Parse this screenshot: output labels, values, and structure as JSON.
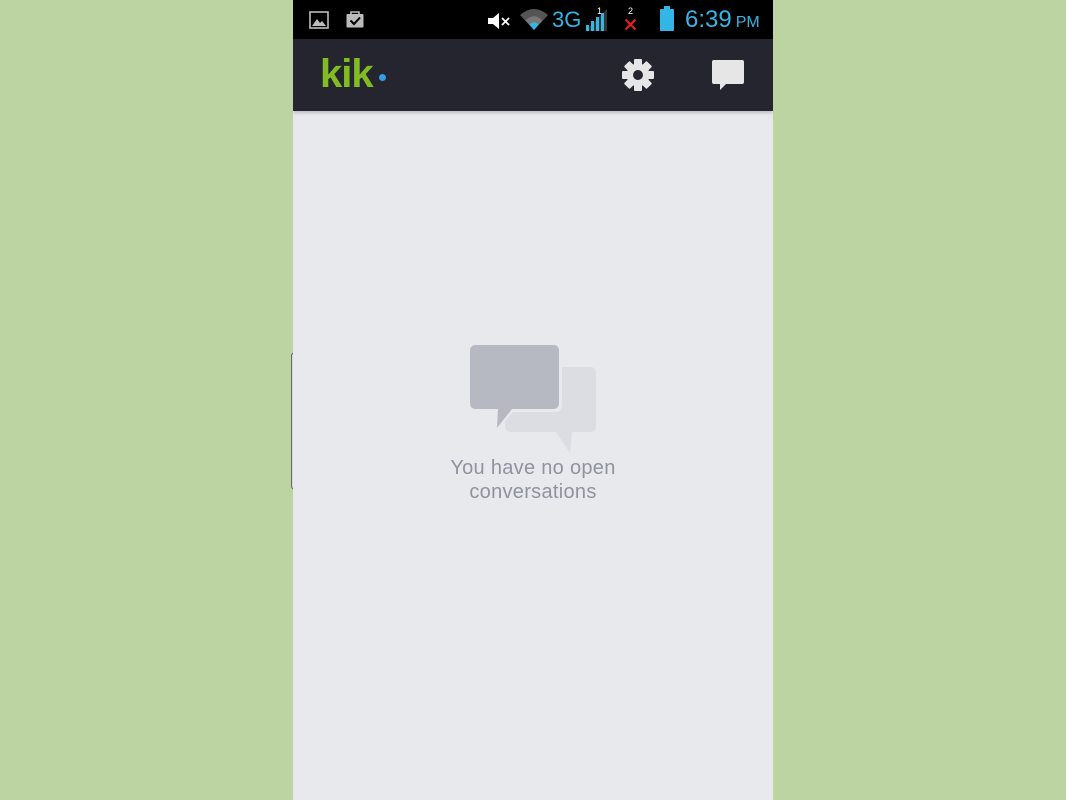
{
  "status_bar": {
    "network_type": "3G",
    "time": "6:39",
    "ampm": "PM",
    "sim1_label": "1",
    "sim2_label": "2",
    "icons": [
      "image-icon",
      "bag-check-icon",
      "mute-icon",
      "wifi-icon",
      "signal-icon",
      "no-signal-icon",
      "battery-icon"
    ]
  },
  "header": {
    "logo": "kik",
    "colors": {
      "background": "#24252e",
      "logo_green": "#82bc23",
      "logo_dot": "#2f9fe3"
    },
    "icons": [
      "settings-gear-icon",
      "new-chat-icon"
    ]
  },
  "empty_state": {
    "line1": "You have no open",
    "line2": "conversations",
    "icon": "chat-bubbles-icon"
  },
  "colors": {
    "page_background": "#bcd3a2",
    "content_background": "#e8e9ed",
    "status_accent": "#33b5e5"
  }
}
